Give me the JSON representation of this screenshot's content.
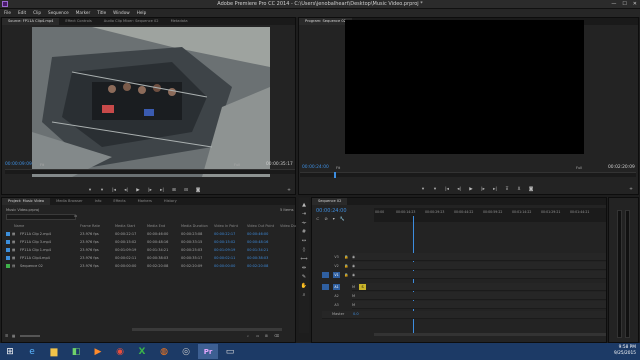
{
  "window": {
    "title": "Adobe Premiere Pro CC 2014 - C:\\Users\\jenobalheart\\Desktop\\Music Video.prproj *",
    "minimize": "—",
    "maximize": "☐",
    "close": "✕"
  },
  "menu": [
    "File",
    "Edit",
    "Clip",
    "Sequence",
    "Marker",
    "Title",
    "Window",
    "Help"
  ],
  "source": {
    "tabs": [
      "Source: FP11A Clip4.mp4",
      "Effect Controls",
      "Audio Clip Mixer: Sequence 02",
      "Metadata"
    ],
    "timecode_in": "00:00:09:09",
    "timecode_dur": "00:00:35:17",
    "fit": "Fit",
    "scale": "Full"
  },
  "program": {
    "tab": "Program: Sequence 02",
    "timecode_in": "00:00:24:00",
    "timecode_dur": "00:02:20:09",
    "fit": "Fit",
    "scale": "Full"
  },
  "project": {
    "tabs": [
      "Project: Music Video",
      "Media Browser",
      "Info",
      "Effects",
      "Markers",
      "History"
    ],
    "filename": "Music Video.prproj",
    "count": "5 Items",
    "columns": [
      "Name",
      "Frame Rate",
      "Media Start",
      "Media End",
      "Media Duration",
      "Video In Point",
      "Video Out Point",
      "Video Du"
    ],
    "items": [
      {
        "name": "FP11A Clip 2.mp4",
        "fps": "23.976 fps",
        "start": "00:00:22:17",
        "end": "00:00:46:00",
        "dur": "00:00:23:08",
        "vin": "00:00:22:17",
        "vout": "00:00:46:00",
        "color": "#3c8fdb"
      },
      {
        "name": "FP11A Clip 3.mp4",
        "fps": "23.976 fps",
        "start": "00:00:15:02",
        "end": "00:00:48:16",
        "dur": "00:00:33:15",
        "vin": "00:00:15:02",
        "vout": "00:00:48:16",
        "color": "#3c8fdb"
      },
      {
        "name": "FP11A Clip 1.mp4",
        "fps": "23.976 fps",
        "start": "00:01:09:19",
        "end": "00:01:34:21",
        "dur": "00:00:25:03",
        "vin": "00:01:09:19",
        "vout": "00:01:34:21",
        "color": "#3c8fdb"
      },
      {
        "name": "FP11A Clip4.mp4",
        "fps": "23.976 fps",
        "start": "00:00:02:11",
        "end": "00:00:38:03",
        "dur": "00:00:35:17",
        "vin": "00:00:02:11",
        "vout": "00:00:38:03",
        "color": "#3c8fdb"
      },
      {
        "name": "Sequence 02",
        "fps": "23.976 fps",
        "start": "00:00:00:00",
        "end": "00:02:20:08",
        "dur": "00:02:20:09",
        "vin": "00:00:00:00",
        "vout": "00:02:20:08",
        "color": "#3fb24a"
      }
    ]
  },
  "timeline": {
    "tab": "Sequence 02",
    "timecode": "00:00:24:00",
    "ruler": [
      "00:00",
      "00:00:14:23",
      "00:00:29:23",
      "00:00:44:22",
      "00:00:59:22",
      "00:01:14:22",
      "00:01:29:21",
      "00:01:44:21"
    ],
    "video_tracks": [
      "V3",
      "V2",
      "V1"
    ],
    "audio_tracks": [
      "A1",
      "A2",
      "A3"
    ],
    "master": "Master",
    "master_val": "0.0",
    "playhead_pct": 0.17
  },
  "taskbar": {
    "time": "9:58 PM",
    "date": "9/25/2015",
    "icons": [
      {
        "name": "start-icon",
        "glyph": "⊞"
      },
      {
        "name": "ie-icon",
        "glyph": "e"
      },
      {
        "name": "explorer-icon",
        "glyph": "▆"
      },
      {
        "name": "store-icon",
        "glyph": "◧"
      },
      {
        "name": "media-icon",
        "glyph": "▶"
      },
      {
        "name": "chrome-icon",
        "glyph": "◉"
      },
      {
        "name": "excel-icon",
        "glyph": "X"
      },
      {
        "name": "firefox-icon",
        "glyph": "◍"
      },
      {
        "name": "steam-icon",
        "glyph": "◎"
      },
      {
        "name": "premiere-icon",
        "glyph": "Pr"
      },
      {
        "name": "app-icon",
        "glyph": "▭"
      }
    ]
  }
}
